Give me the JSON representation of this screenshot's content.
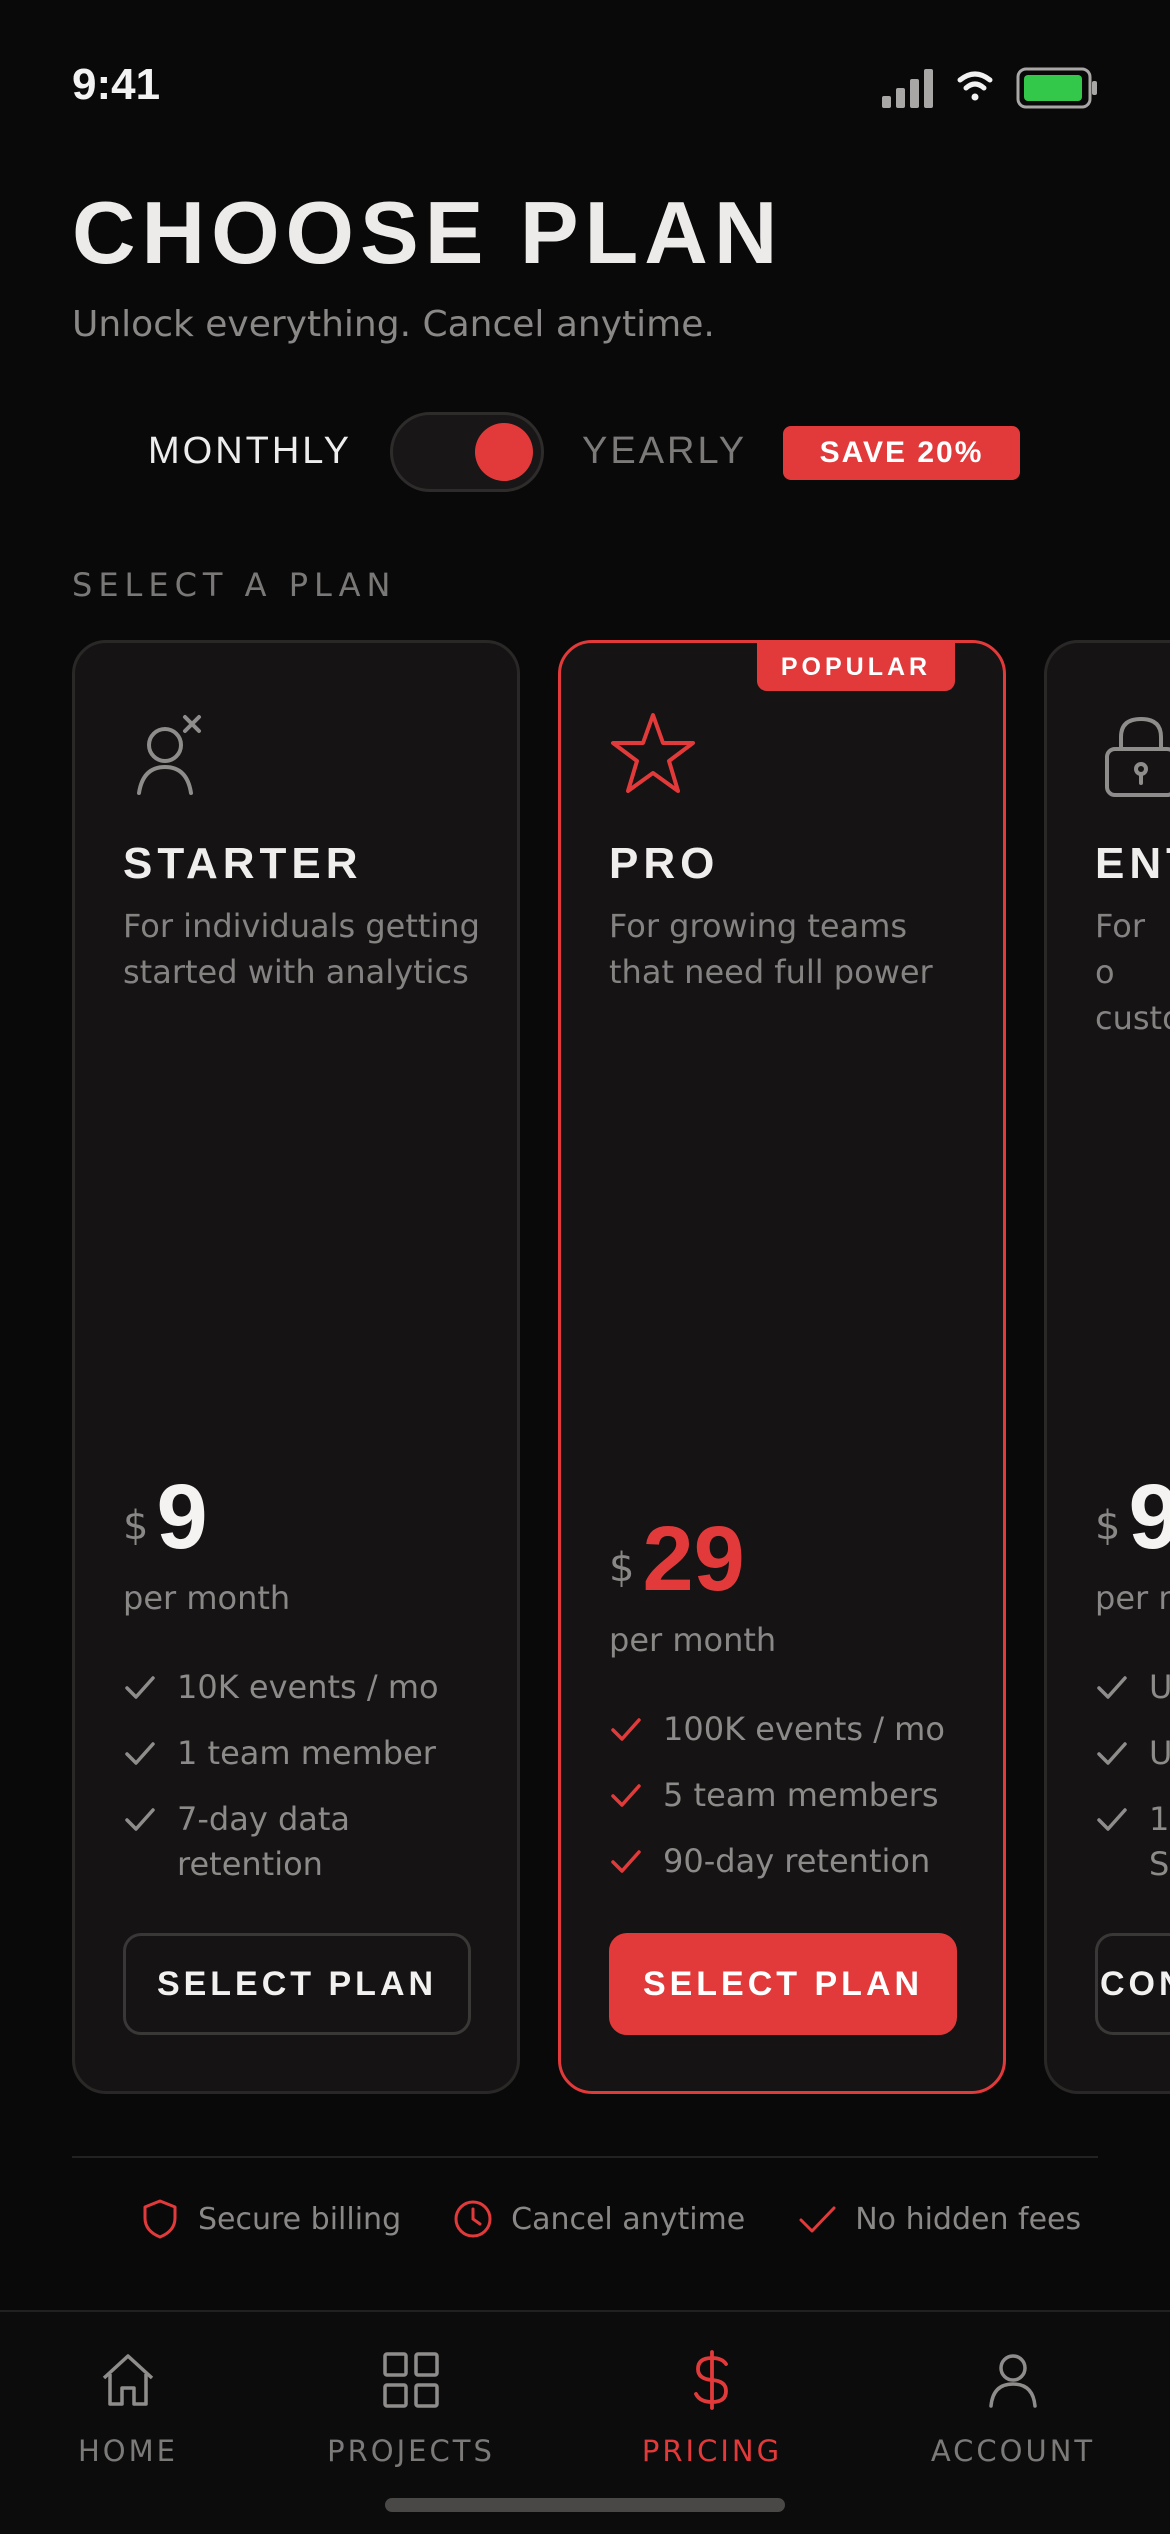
{
  "status_bar": {
    "time": "9:41"
  },
  "header": {
    "title": "CHOOSE PLAN",
    "subtitle": "Unlock everything. Cancel anytime."
  },
  "billing": {
    "monthly_label": "MONTHLY",
    "yearly_label": "YEARLY",
    "save_badge": "SAVE 20%",
    "toggle_selected": "YEARLY"
  },
  "section_label": "SELECT A PLAN",
  "plans": [
    {
      "name": "STARTER",
      "icon": "user-x-icon",
      "description": "For individuals getting started with analytics",
      "currency": "$",
      "price": "9",
      "period": "per month",
      "features": [
        "10K events / mo",
        "1 team member",
        "7-day data retention"
      ],
      "button": "SELECT PLAN"
    },
    {
      "name": "PRO",
      "icon": "star-icon",
      "badge": "POPULAR",
      "description": "For growing teams that need full power",
      "currency": "$",
      "price": "29",
      "period": "per month",
      "features": [
        "100K events / mo",
        "5 team members",
        "90-day retention"
      ],
      "button": "SELECT PLAN"
    },
    {
      "name": "ENT",
      "icon": "lock-icon",
      "description": "For o custo",
      "currency": "$",
      "price": "9",
      "period": "per m",
      "features": [
        "U",
        "U",
        "1 S"
      ],
      "button": "CON"
    }
  ],
  "trust": [
    {
      "icon": "shield-icon",
      "label": "Secure billing"
    },
    {
      "icon": "clock-icon",
      "label": "Cancel anytime"
    },
    {
      "icon": "check-icon",
      "label": "No hidden fees"
    }
  ],
  "tabs": [
    {
      "icon": "home-icon",
      "label": "HOME"
    },
    {
      "icon": "grid-icon",
      "label": "PROJECTS"
    },
    {
      "icon": "dollar-icon",
      "label": "PRICING",
      "active": true
    },
    {
      "icon": "user-icon",
      "label": "ACCOUNT"
    }
  ],
  "colors": {
    "background": "#0a0909",
    "accent": "#e23a3a",
    "card": "#151313",
    "battery": "#34c84a"
  }
}
